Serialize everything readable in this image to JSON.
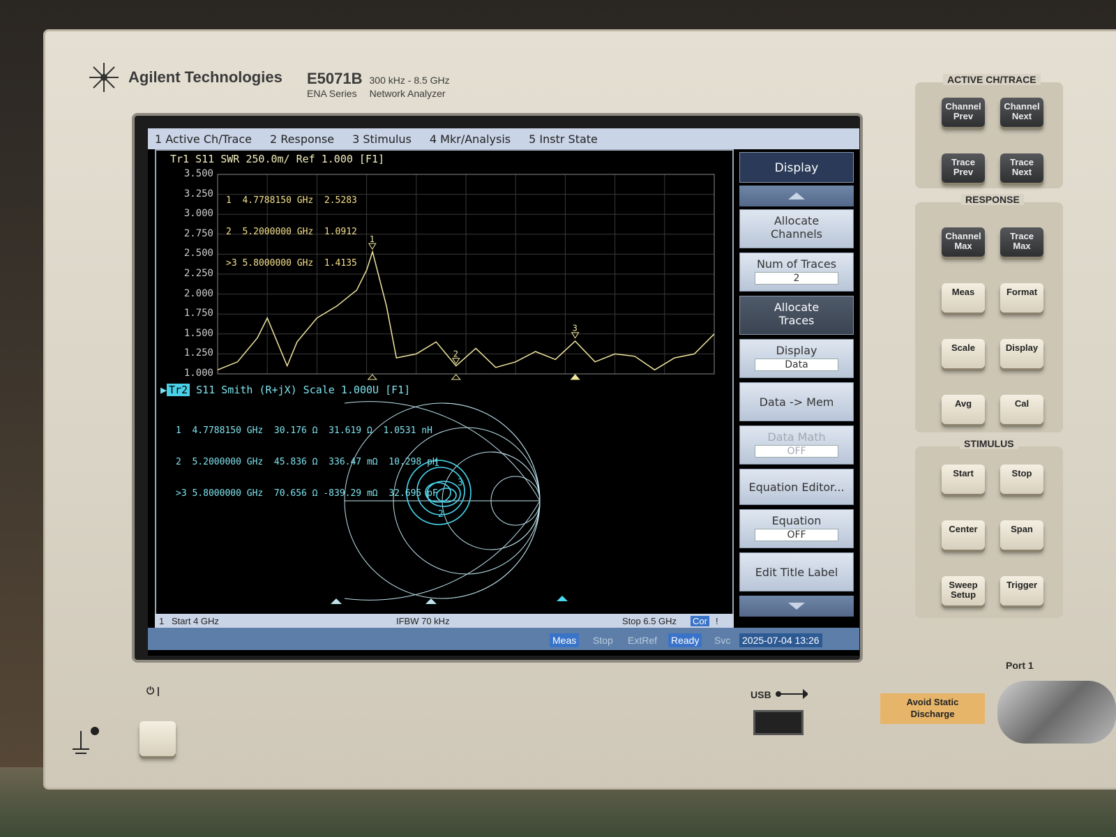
{
  "brand": {
    "name": "Agilent Technologies",
    "model": "E5071B",
    "range": "300 kHz - 8.5 GHz",
    "series": "ENA Series",
    "kind": "Network Analyzer"
  },
  "menubar": [
    "1 Active Ch/Trace",
    "2 Response",
    "3 Stimulus",
    "4 Mkr/Analysis",
    "5 Instr State"
  ],
  "trace1": {
    "header": "Tr1  S11  SWR  250.0m/ Ref 1.000  [F1]",
    "markers": [
      {
        "id": "1",
        "freq": "4.7788150 GHz",
        "value": "2.5283"
      },
      {
        "id": "2",
        "freq": "5.2000000 GHz",
        "value": "1.0912"
      },
      {
        "id": ">3",
        "freq": "5.8000000 GHz",
        "value": "1.4135"
      }
    ],
    "yticks": [
      "3.500",
      "3.250",
      "3.000",
      "2.750",
      "2.500",
      "2.250",
      "2.000",
      "1.750",
      "1.500",
      "1.250",
      "1.000"
    ]
  },
  "trace2": {
    "chip": "Tr2",
    "header": "S11  Smith  (R+jX)  Scale 1.000U  [F1]",
    "markers": [
      {
        "id": "1",
        "freq": "4.7788150 GHz",
        "r": "30.176 Ω",
        "x": "31.619 Ω",
        "lc": "1.0531 nH"
      },
      {
        "id": "2",
        "freq": "5.2000000 GHz",
        "r": "45.836 Ω",
        "x": "336.47 mΩ",
        "lc": "10.298 pH"
      },
      {
        "id": ">3",
        "freq": "5.8000000 GHz",
        "r": "70.656 Ω",
        "x": "-839.29 mΩ",
        "lc": "32.695 pF"
      }
    ]
  },
  "status": {
    "start": "Start 4 GHz",
    "ifbw": "IFBW 70 kHz",
    "stop": "Stop 6.5 GHz",
    "cor": "Cor",
    "ch": "1",
    "excl": "!"
  },
  "bottom": {
    "meas": "Meas",
    "stop": "Stop",
    "extref": "ExtRef",
    "ready": "Ready",
    "svc": "Svc",
    "datetime": "2025-07-04 13:26"
  },
  "softkeys": {
    "title": "Display",
    "allocate_channels": "Allocate\nChannels",
    "num_traces": "Num of Traces",
    "num_traces_val": "2",
    "allocate_traces": "Allocate\nTraces",
    "display": "Display",
    "display_val": "Data",
    "data_mem": "Data -> Mem",
    "data_math": "Data Math",
    "data_math_val": "OFF",
    "eq_editor": "Equation Editor...",
    "equation": "Equation",
    "equation_val": "OFF",
    "edit_title": "Edit Title Label"
  },
  "panel": {
    "active_title": "ACTIVE CH/TRACE",
    "response_title": "RESPONSE",
    "stimulus_title": "STIMULUS",
    "keys_active": [
      "Channel\nPrev",
      "Channel\nNext",
      "Trace\nPrev",
      "Trace\nNext"
    ],
    "keys_response": [
      "Channel\nMax",
      "Trace\nMax",
      "Meas",
      "Format",
      "Scale",
      "Display",
      "Avg",
      "Cal"
    ],
    "keys_stimulus": [
      "Start",
      "Stop",
      "Center",
      "Span",
      "Sweep\nSetup",
      "Trigger"
    ]
  },
  "front": {
    "usb": "USB",
    "port": "Port 1",
    "static": "Avoid Static\nDischarge",
    "power": "⏻ |"
  },
  "chart_data": {
    "type": "line",
    "x_unit": "GHz",
    "xlim": [
      4,
      6.5
    ],
    "ylim": [
      1.0,
      3.5
    ],
    "x": [
      4.0,
      4.1,
      4.2,
      4.25,
      4.3,
      4.35,
      4.4,
      4.5,
      4.6,
      4.7,
      4.75,
      4.78,
      4.85,
      4.9,
      5.0,
      5.1,
      5.2,
      5.3,
      5.4,
      5.5,
      5.6,
      5.7,
      5.8,
      5.9,
      6.0,
      6.1,
      6.2,
      6.3,
      6.4,
      6.5
    ],
    "y": [
      1.05,
      1.15,
      1.45,
      1.7,
      1.4,
      1.1,
      1.4,
      1.7,
      1.85,
      2.05,
      2.3,
      2.53,
      1.85,
      1.2,
      1.25,
      1.4,
      1.1,
      1.32,
      1.08,
      1.15,
      1.28,
      1.18,
      1.41,
      1.15,
      1.25,
      1.22,
      1.05,
      1.2,
      1.25,
      1.5
    ]
  }
}
